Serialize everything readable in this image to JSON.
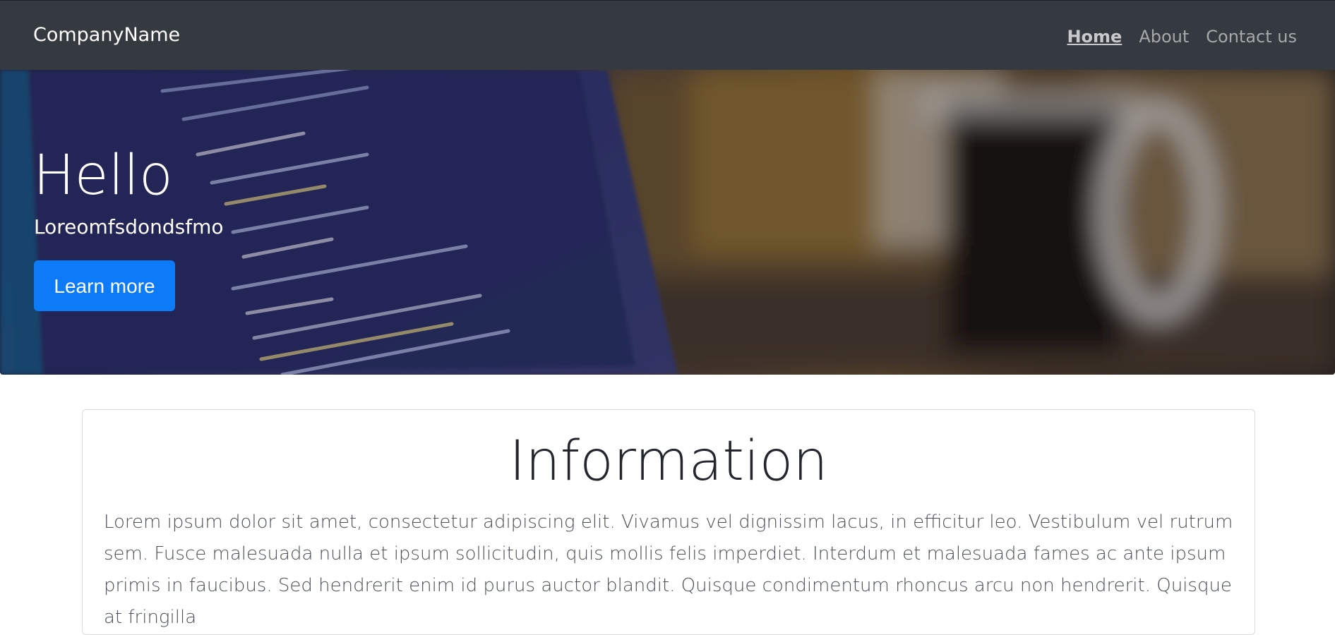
{
  "navbar": {
    "brand": "CompanyName",
    "links": [
      {
        "label": "Home"
      },
      {
        "label": "About"
      },
      {
        "label": "Contact us"
      }
    ]
  },
  "hero": {
    "title": "Hello",
    "subtitle": "Loreomfsdondsfmo",
    "button_label": "Learn more"
  },
  "info": {
    "title": "Information",
    "text": "Lorem ipsum dolor sit amet, consectetur adipiscing elit. Vivamus vel dignissim lacus, in efficitur leo. Vestibulum vel rutrum sem. Fusce malesuada nulla et ipsum sollicitudin, quis mollis felis imperdiet. Interdum et malesuada fames ac ante ipsum primis in faucibus. Sed hendrerit enim id purus auctor blandit. Quisque condimentum rhoncus arcu non hendrerit. Quisque at fringilla"
  },
  "colors": {
    "navbar_bg": "#343a40",
    "primary_button": "#0d7bf7",
    "text_dark": "#23272b"
  }
}
